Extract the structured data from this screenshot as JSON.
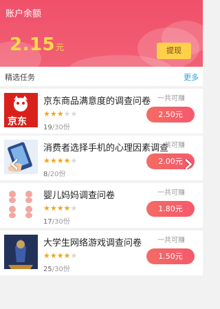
{
  "header": {
    "title": "账户余额",
    "balance": "2.15",
    "unit": "元",
    "withdraw_label": "提现"
  },
  "section": {
    "label": "精选任务",
    "more": "更多"
  },
  "tasks": [
    {
      "name": "京东商品满意度的调查问卷",
      "stars_label": "★★★☆☆",
      "rating": 3,
      "done": "19",
      "total": "/30份",
      "earn": "一共可赚",
      "price": "2.50元",
      "thumb_text": "京东"
    },
    {
      "name": "消费者选择手机的心理因素调查",
      "stars_label": "★★★★☆",
      "rating": 4,
      "done": "8",
      "total": "/20份",
      "earn": "一共可赚",
      "price": "2.00元"
    },
    {
      "name": "婴儿妈妈调查问卷",
      "stars_label": "★★★★☆",
      "rating": 4,
      "done": "17",
      "total": "/30份",
      "earn": "一共可赚",
      "price": "1.80元"
    },
    {
      "name": "大学生网络游戏调查问卷",
      "stars_label": "★★★★☆",
      "rating": 4,
      "done": "25",
      "total": "/30份",
      "earn": "一共可赚",
      "price": "1.50元"
    }
  ],
  "carousel": {
    "prev_icon": "chevron-left-icon",
    "next_icon": "chevron-right-icon"
  },
  "colors": {
    "header": "#f0506a",
    "balance": "#ffd84a",
    "button": "#ffd04a",
    "price": "#f5596d",
    "link": "#2aa0d8"
  }
}
